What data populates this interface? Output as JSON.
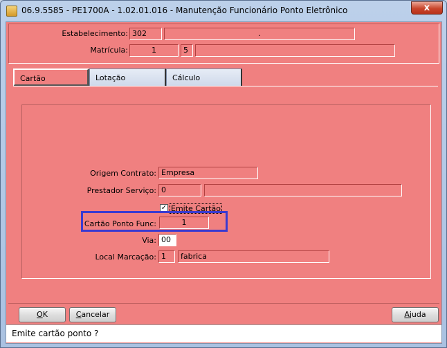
{
  "window": {
    "title": "06.9.5585 - PE1700A - 1.02.01.016 - Manutenção Funcionário Ponto Eletrônico",
    "close_label": "x"
  },
  "header": {
    "estabelecimento_label": "Estabelecimento:",
    "estabelecimento_code": "302",
    "estabelecimento_name": ".",
    "matricula_label": "Matrícula:",
    "matricula_value": "1",
    "matricula_digit": "5",
    "matricula_name": ""
  },
  "tabs": [
    {
      "label": "Cartão",
      "active": true
    },
    {
      "label": "Lotação",
      "active": false
    },
    {
      "label": "Cálculo",
      "active": false
    }
  ],
  "form": {
    "origem_label": "Origem Contrato:",
    "origem_value": "Empresa",
    "prestador_label": "Prestador Serviço:",
    "prestador_code": "0",
    "prestador_name": "",
    "emite_cartao_label": "Emite Cartão",
    "emite_cartao_checked": true,
    "emite_cartao_mark": "✓",
    "cartao_ponto_label": "Cartão Ponto Func:",
    "cartao_ponto_value": "1",
    "via_label": "Via:",
    "via_value": "00",
    "local_label": "Local Marcação:",
    "local_code": "1",
    "local_name": "fabrica"
  },
  "buttons": {
    "ok_first": "O",
    "ok_rest": "K",
    "cancel_first": "C",
    "cancel_rest": "ancelar",
    "help_first": "A",
    "help_rest": "juda"
  },
  "status": {
    "text": "Emite cartão ponto ?"
  },
  "colors": {
    "form_background": "#f08080",
    "highlight_border": "#3a3ad0"
  }
}
